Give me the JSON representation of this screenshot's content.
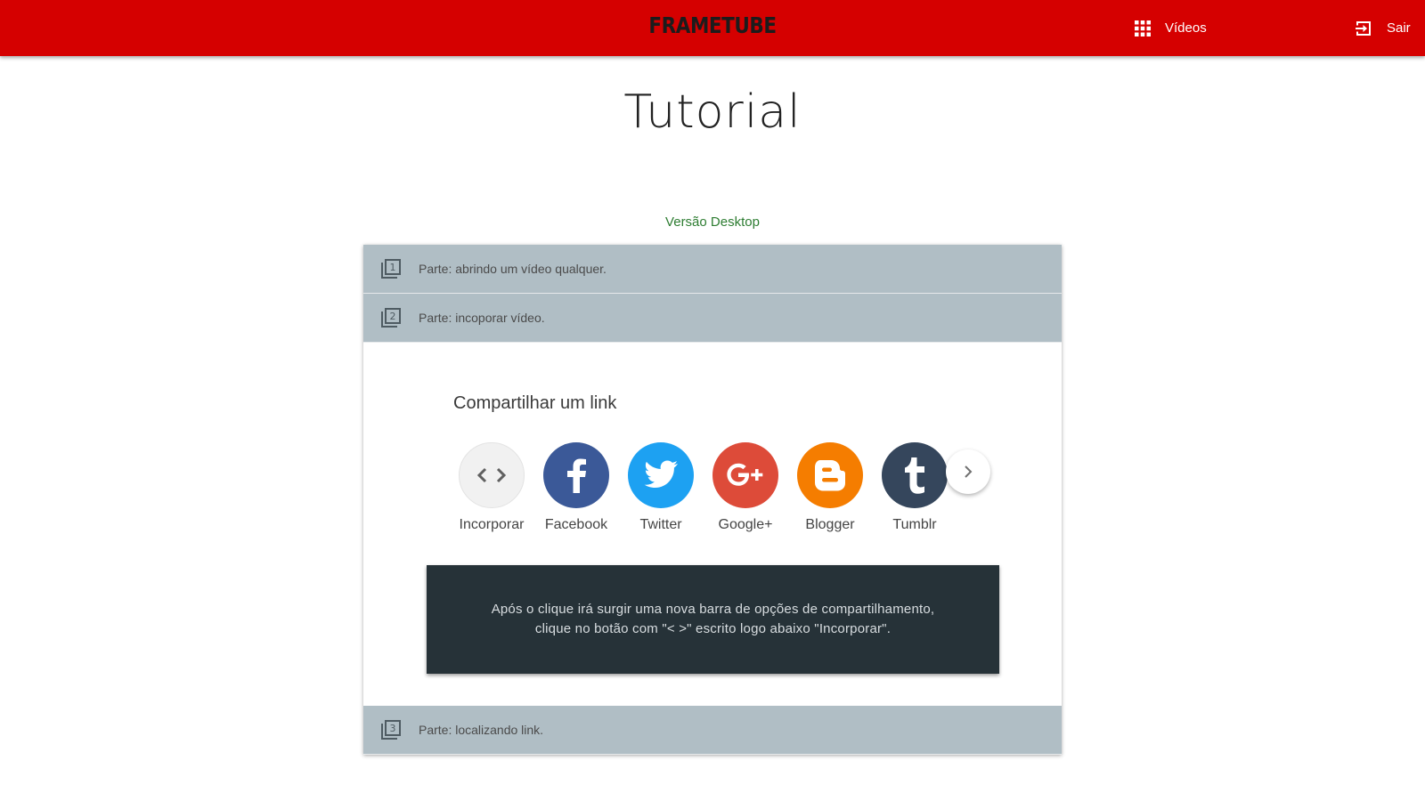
{
  "header": {
    "brand": "FRAMETUBE",
    "nav": [
      {
        "label": "Vídeos",
        "icon": "apps-grid-icon"
      },
      {
        "label": "Sair",
        "icon": "exit-icon"
      }
    ],
    "bar_color": "#d50000"
  },
  "page": {
    "title": "Tutorial",
    "subtitle": "Versão Desktop"
  },
  "sections": [
    {
      "number": "1",
      "label": "Parte: abrindo um vídeo qualquer."
    },
    {
      "number": "2",
      "label": "Parte: incoporar vídeo."
    },
    {
      "number": "3",
      "label": "Parte: localizando link."
    }
  ],
  "share": {
    "title": "Compartilhar um link",
    "items": [
      {
        "label": "Incorporar",
        "icon": "embed-code-icon",
        "color": "#f1f1f1"
      },
      {
        "label": "Facebook",
        "icon": "facebook-icon",
        "color": "#3b5998"
      },
      {
        "label": "Twitter",
        "icon": "twitter-icon",
        "color": "#1da1f2"
      },
      {
        "label": "Google+",
        "icon": "google-plus-icon",
        "color": "#dd4b39"
      },
      {
        "label": "Blogger",
        "icon": "blogger-icon",
        "color": "#f57d00"
      },
      {
        "label": "Tumblr",
        "icon": "tumblr-icon",
        "color": "#35465c"
      }
    ]
  },
  "info": {
    "line1": "Após o clique irá surgir uma nova barra de opções de compartilhamento,",
    "line2": "clique no botão com \"< >\" escrito logo abaixo \"Incorporar\"."
  }
}
